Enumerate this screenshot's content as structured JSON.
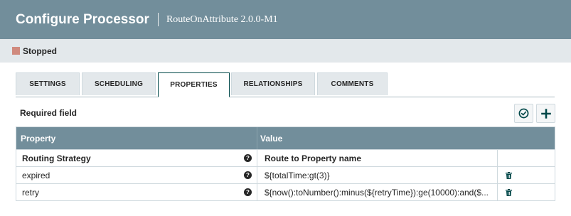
{
  "header": {
    "title": "Configure Processor",
    "subtitle": "RouteOnAttribute 2.0.0-M1"
  },
  "status": {
    "label": "Stopped",
    "color": "#d08a7e"
  },
  "tabs": [
    {
      "label": "SETTINGS",
      "active": false
    },
    {
      "label": "SCHEDULING",
      "active": false
    },
    {
      "label": "PROPERTIES",
      "active": true
    },
    {
      "label": "RELATIONSHIPS",
      "active": false
    },
    {
      "label": "COMMENTS",
      "active": false
    }
  ],
  "properties": {
    "required_label": "Required field",
    "verify_icon": "check-circle-icon",
    "add_icon": "plus-icon",
    "columns": {
      "property": "Property",
      "value": "Value"
    },
    "rows": [
      {
        "name": "Routing Strategy",
        "value": "Route to Property name",
        "required": true,
        "deletable": false
      },
      {
        "name": "expired",
        "value": "${totalTime:gt(3)}",
        "required": false,
        "deletable": true
      },
      {
        "name": "retry",
        "value": "${now():toNumber():minus(${retryTime}):ge(10000):and($...",
        "required": false,
        "deletable": true
      }
    ]
  },
  "colors": {
    "header_bg": "#728e9b",
    "status_bar_bg": "#e3e8eb",
    "accent": "#004849"
  }
}
